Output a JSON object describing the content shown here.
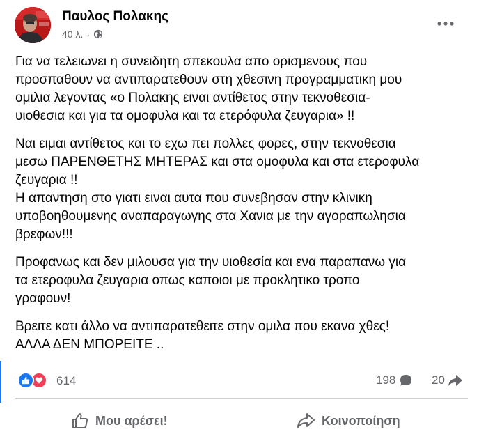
{
  "post": {
    "author": "Παυλος Πολακης",
    "time": "40 λ.",
    "separator": "·",
    "privacy_icon": "globe-icon",
    "menu_icon": "more-options-icon",
    "paragraphs": [
      [
        "Για να τελειωνει η συνειδητη σπεκουλα απο ορισμενους που",
        "προσπαθουν να αντιπαρατεθουν στη χθεσινη προγραμματικη μου",
        "ομιλια λεγοντας «ο Πολακης ειναι αντίθετος στην τεκνοθεσια-",
        "υιοθεσια και για τα ομοφυλα και τα  ετερόφυλα ζευγαρια» !!"
      ],
      [
        "Ναι ειμαι αντίθετος και το εχω πει πολλες φορες, στην τεκνοθεσια",
        "μεσω ΠΑΡΕΝΘΕΤΗΣ ΜΗΤΕΡΑΣ και στα ομοφυλα και στα ετεροφυλα",
        "ζευγαρια !!",
        "Η απαντηση στο γιατι ειναι αυτα που συνεβησαν στην κλινικη",
        "υποβοηθουμενης αναπαραγωγης στα Χανια με την αγοραπωλησια",
        "βρεφων!!!"
      ],
      [
        "Προφανως και δεν μιλουσα για  την υιοθεσία και ενα παραπανω για",
        "τα ετεροφυλα ζευγαρια οπως καποιοι με προκλητικο τροπο",
        "γραφουν!"
      ],
      [
        "Βρειτε κατι άλλο να αντιπαρατεθειτε στην ομιλα που εκανα χθες!",
        "ΑΛΛΑ ΔΕΝ ΜΠΟΡΕΙΤΕ .."
      ]
    ]
  },
  "stats": {
    "reaction_icons": [
      "like-reaction-icon",
      "love-reaction-icon"
    ],
    "reactions_count": "614",
    "comments_count": "198",
    "shares_count": "20"
  },
  "actions": {
    "like_label": "Μου αρέσει!",
    "share_label": "Κοινοποίηση"
  },
  "colors": {
    "accent": "#1877f2",
    "love": "#f33e58",
    "secondary_text": "#65676b",
    "text": "#050505",
    "divider": "#ced0d4"
  }
}
